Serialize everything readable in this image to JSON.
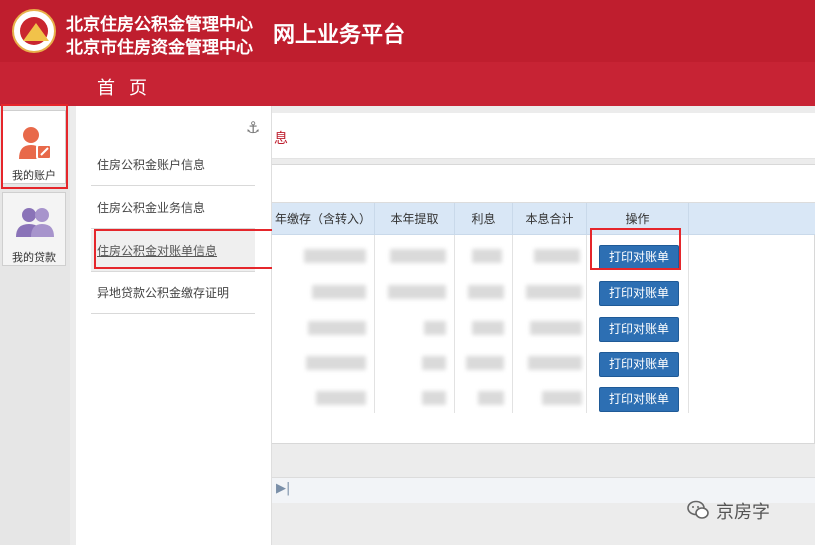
{
  "header": {
    "org_line1": "北京住房公积金管理中心",
    "org_line2": "北京市住房资金管理中心",
    "platform_title": "网上业务平台"
  },
  "nav": {
    "home": "首页"
  },
  "left_tabs": [
    {
      "label": "我的账户",
      "icon": "account-edit-icon"
    },
    {
      "label": "我的贷款",
      "icon": "users-icon"
    }
  ],
  "submenu": {
    "items": [
      {
        "label": "住房公积金账户信息"
      },
      {
        "label": "住房公积金业务信息"
      },
      {
        "label": "住房公积金对账单信息"
      },
      {
        "label": "异地贷款公积金缴存证明"
      }
    ]
  },
  "breadcrumb": {
    "fragment": "息"
  },
  "table": {
    "columns": [
      "年缴存（含转入）",
      "本年提取",
      "利息",
      "本息合计",
      "操作"
    ],
    "row_action": "打印对账单",
    "row_count": 5
  },
  "watermark": {
    "text": "京房字"
  },
  "colors": {
    "header_red": "#bf1e2e",
    "nav_red": "#c72334",
    "button_blue": "#2d6fb3",
    "highlight_red": "#e5262b"
  }
}
